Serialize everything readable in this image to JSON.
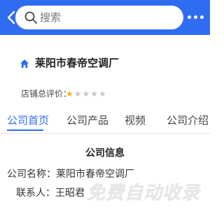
{
  "colors": {
    "accent": "#2f6df0",
    "star_on": "#f3b51d",
    "star_off": "#c8c8c8"
  },
  "header": {
    "back_icon": "chevron-left-icon",
    "search": {
      "icon": "search-icon",
      "placeholder": "搜索"
    },
    "menu_icon": "more-dots-icon"
  },
  "shop": {
    "icon": "home-icon",
    "name": "莱阳市春帝空调厂",
    "rating_label": "店铺总评价：",
    "rating": {
      "filled": 1,
      "total": 5
    }
  },
  "tabs": [
    {
      "label": "公司首页",
      "active": true
    },
    {
      "label": "公司产品",
      "active": false
    },
    {
      "label": "视频",
      "active": false
    },
    {
      "label": "公司介绍",
      "active": false
    }
  ],
  "company_info": {
    "title": "公司信息",
    "rows": [
      {
        "label": "公司名称：",
        "value": "莱阳市春帝空调厂"
      },
      {
        "label": "联系人：",
        "value": "王昭君"
      }
    ]
  },
  "watermark": "免费自动收录"
}
